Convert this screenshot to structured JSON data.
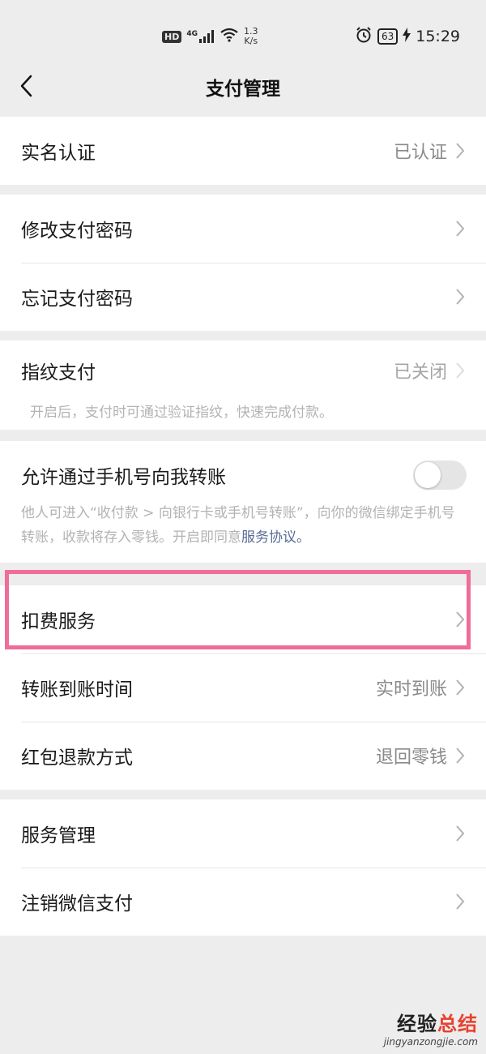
{
  "status_bar": {
    "hd": "HD",
    "network": "4G",
    "speed_value": "1.3",
    "speed_unit": "K/s",
    "battery": "63",
    "time": "15:29"
  },
  "nav": {
    "title": "支付管理"
  },
  "groups": {
    "g1": {
      "real_name": {
        "label": "实名认证",
        "value": "已认证"
      }
    },
    "g2": {
      "change_pwd": {
        "label": "修改支付密码"
      },
      "forgot_pwd": {
        "label": "忘记支付密码"
      }
    },
    "g3": {
      "fingerprint": {
        "label": "指纹支付",
        "value": "已关闭",
        "desc": "开启后，支付时可通过验证指纹，快速完成付款。"
      }
    },
    "g4": {
      "phone_transfer": {
        "label": "允许通过手机号向我转账",
        "desc": "他人可进入“收付款 > 向银行卡或手机号转账”，向你的微信绑定手机号转账，收款将存入零钱。开启即同意",
        "link": "服务协议。",
        "enabled": false
      }
    },
    "g5": {
      "deduction": {
        "label": "扣费服务"
      },
      "transfer_time": {
        "label": "转账到账时间",
        "value": "实时到账"
      },
      "red_packet_refund": {
        "label": "红包退款方式",
        "value": "退回零钱"
      }
    },
    "g6": {
      "service_mgmt": {
        "label": "服务管理"
      },
      "cancel_pay": {
        "label": "注销微信支付"
      }
    }
  },
  "watermark": {
    "cn_main": "经验",
    "cn_accent": "总结",
    "url": "jingyanzongjie.com"
  },
  "colors": {
    "background": "#ededed",
    "highlight": "#f06c99",
    "link": "#576b95"
  }
}
